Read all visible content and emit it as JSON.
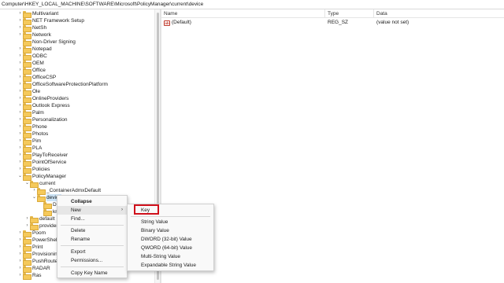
{
  "address": "Computer\\HKEY_LOCAL_MACHINE\\SOFTWARE\\Microsoft\\PolicyManager\\current\\device",
  "tree": {
    "items": [
      {
        "label": "Multivariant",
        "indent": 0,
        "chevron": "›"
      },
      {
        "label": "NET Framework Setup",
        "indent": 0,
        "chevron": "›"
      },
      {
        "label": "NetSh",
        "indent": 0,
        "chevron": "›"
      },
      {
        "label": "Network",
        "indent": 0,
        "chevron": "›"
      },
      {
        "label": "Non-Driver Signing",
        "indent": 0,
        "chevron": ""
      },
      {
        "label": "Notepad",
        "indent": 0,
        "chevron": "›"
      },
      {
        "label": "ODBC",
        "indent": 0,
        "chevron": "›"
      },
      {
        "label": "OEM",
        "indent": 0,
        "chevron": "›"
      },
      {
        "label": "Office",
        "indent": 0,
        "chevron": "›"
      },
      {
        "label": "OfficeCSP",
        "indent": 0,
        "chevron": "›"
      },
      {
        "label": "OfficeSoftwareProtectionPlatform",
        "indent": 0,
        "chevron": "›"
      },
      {
        "label": "Ole",
        "indent": 0,
        "chevron": "›"
      },
      {
        "label": "OnlineProviders",
        "indent": 0,
        "chevron": "›"
      },
      {
        "label": "Outlook Express",
        "indent": 0,
        "chevron": "›"
      },
      {
        "label": "Palm",
        "indent": 0,
        "chevron": "›"
      },
      {
        "label": "Personalization",
        "indent": 0,
        "chevron": "›"
      },
      {
        "label": "Phone",
        "indent": 0,
        "chevron": "›"
      },
      {
        "label": "Photos",
        "indent": 0,
        "chevron": "›"
      },
      {
        "label": "Pim",
        "indent": 0,
        "chevron": "›"
      },
      {
        "label": "PLA",
        "indent": 0,
        "chevron": "›"
      },
      {
        "label": "PlayToReceiver",
        "indent": 0,
        "chevron": "›"
      },
      {
        "label": "PointOfService",
        "indent": 0,
        "chevron": "›"
      },
      {
        "label": "Policies",
        "indent": 0,
        "chevron": "›"
      },
      {
        "label": "PolicyManager",
        "indent": 0,
        "chevron": "⌄"
      },
      {
        "label": "current",
        "indent": 1,
        "chevron": "⌄"
      },
      {
        "label": "_ContainerAdmxDefault",
        "indent": 2,
        "chevron": "›"
      },
      {
        "label": "device",
        "indent": 2,
        "chevron": "⌄",
        "selected": true
      },
      {
        "label": "D",
        "indent": 3,
        "chevron": ""
      },
      {
        "label": "kn",
        "indent": 3,
        "chevron": ""
      },
      {
        "label": "default",
        "indent": 1,
        "chevron": "›"
      },
      {
        "label": "provider",
        "indent": 1,
        "chevron": "›"
      },
      {
        "label": "Poom",
        "indent": 0,
        "chevron": "›"
      },
      {
        "label": "PowerShell",
        "indent": 0,
        "chevron": "›"
      },
      {
        "label": "Print",
        "indent": 0,
        "chevron": "›"
      },
      {
        "label": "Provisioning",
        "indent": 0,
        "chevron": "›"
      },
      {
        "label": "PushRouter",
        "indent": 0,
        "chevron": "›"
      },
      {
        "label": "RADAR",
        "indent": 0,
        "chevron": "›"
      },
      {
        "label": "Ras",
        "indent": 0,
        "chevron": "›"
      }
    ]
  },
  "list": {
    "columns": {
      "name": "Name",
      "type": "Type",
      "data": "Data"
    },
    "rows": [
      {
        "name": "(Default)",
        "type": "REG_SZ",
        "data": "(value not set)",
        "icon": "string-value-icon"
      }
    ]
  },
  "context_menu": {
    "collapse": "Collapse",
    "new": "New",
    "find": "Find...",
    "delete": "Delete",
    "rename": "Rename",
    "export": "Export",
    "permissions": "Permissions...",
    "copy_key_name": "Copy Key Name",
    "submenu_arrow": "›"
  },
  "submenu": {
    "key": "Key",
    "string_value": "String Value",
    "binary_value": "Binary Value",
    "dword_value": "DWORD (32-bit) Value",
    "qword_value": "QWORD (64-bit) Value",
    "multi_string_value": "Multi-String Value",
    "expandable_string_value": "Expandable String Value"
  },
  "colors": {
    "highlight_box": "#d0101b",
    "folder": "#f5c95b",
    "selection": "#cce4f7"
  }
}
